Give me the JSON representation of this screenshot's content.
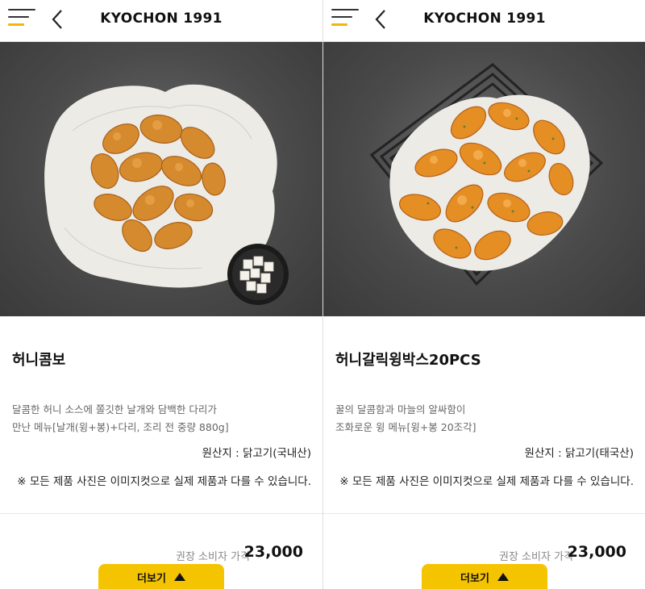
{
  "panels": [
    {
      "header": {
        "brand": "KYOCHON 1991",
        "menu_icon": "hamburger-menu-icon",
        "back_icon": "chevron-left-icon"
      },
      "product": {
        "name": "허니콤보",
        "desc_line1": "달콤한 허니 소스에 쫄깃한 날개와 담백한 다리가",
        "desc_line2": "만난 메뉴[날개(윙+봉)+다리, 조리 전 중량 880g]",
        "origin": "원산지 : 닭고기(국내산)",
        "notice": "※ 모든 제품 사진은 이미지컷으로 실제 제품과 다를 수 있습니다.",
        "price_label": "권장 소비자 가격",
        "price": "23,000",
        "more_label": "더보기"
      }
    },
    {
      "header": {
        "brand": "KYOCHON 1991",
        "menu_icon": "hamburger-menu-icon",
        "back_icon": "chevron-left-icon"
      },
      "product": {
        "name": "허니갈릭윙박스20PCS",
        "desc_line1": "꿀의 달콤함과 마늘의 알싸함이",
        "desc_line2": "조화로운 윙 메뉴[윙+봉 20조각]",
        "origin": "원산지 : 닭고기(태국산)",
        "notice": "※ 모든 제품 사진은 이미지컷으로 실제 제품과 다를 수 있습니다.",
        "price_label": "권장 소비자 가격",
        "price": "23,000",
        "more_label": "더보기"
      }
    }
  ],
  "colors": {
    "accent": "#f5c400",
    "text": "#111111",
    "muted": "#888888",
    "photo_bg": "#4a4a4a",
    "chicken_crispy": "#d98a2b",
    "chicken_glazed": "#e5922a"
  }
}
